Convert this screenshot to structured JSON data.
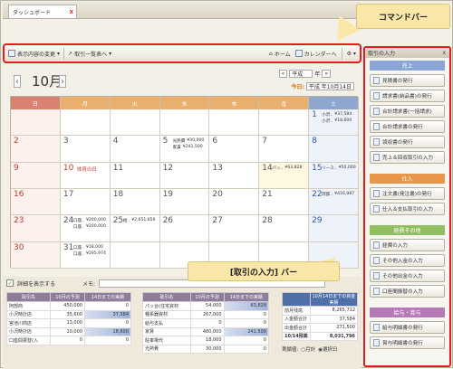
{
  "tab": {
    "label": "ダッシュボード",
    "close": "x"
  },
  "callouts": {
    "command_bar": "コマンドバー",
    "entry_bar": "[取引の入力] バー"
  },
  "toolbar": {
    "display_change": "表示内容の変更",
    "list": "取引一覧表へ",
    "home": "ホーム",
    "calendar": "カレンダーへ"
  },
  "calendar": {
    "month": "10月",
    "era": "平成",
    "year": "年",
    "today_label": "今日:",
    "today_value": "平成  年10月14日",
    "days": [
      "日",
      "月",
      "火",
      "水",
      "木",
      "金",
      "土"
    ],
    "cells": [
      {
        "d": "",
        "evs": []
      },
      {
        "d": "",
        "evs": []
      },
      {
        "d": "",
        "evs": []
      },
      {
        "d": "",
        "evs": []
      },
      {
        "d": "",
        "evs": []
      },
      {
        "d": "",
        "evs": []
      },
      {
        "d": "1",
        "evs": [
          [
            "小沢..",
            "¥37,584"
          ],
          [
            "小沢..",
            "¥18,600"
          ]
        ]
      },
      {
        "d": "2",
        "evs": []
      },
      {
        "d": "3",
        "evs": []
      },
      {
        "d": "4",
        "evs": []
      },
      {
        "d": "5",
        "evs": [
          [
            "光熱費",
            "¥30,000"
          ],
          [
            "家賃",
            "¥241,500"
          ]
        ]
      },
      {
        "d": "6",
        "evs": []
      },
      {
        "d": "7",
        "evs": []
      },
      {
        "d": "8",
        "evs": []
      },
      {
        "d": "9",
        "evs": []
      },
      {
        "d": "10",
        "holiday": "体育の日",
        "evs": []
      },
      {
        "d": "11",
        "evs": []
      },
      {
        "d": "12",
        "evs": []
      },
      {
        "d": "13",
        "evs": []
      },
      {
        "d": "14",
        "evs": [
          [
            "パッ..",
            "¥63,828"
          ]
        ]
      },
      {
        "d": "15",
        "evs": [
          [
            "リース..",
            "¥50,000"
          ]
        ]
      },
      {
        "d": "16",
        "evs": []
      },
      {
        "d": "17",
        "evs": []
      },
      {
        "d": "18",
        "evs": []
      },
      {
        "d": "19",
        "evs": []
      },
      {
        "d": "20",
        "evs": []
      },
      {
        "d": "21",
        "evs": []
      },
      {
        "d": "22",
        "evs": [
          [
            "阿部..",
            "¥416,987"
          ]
        ]
      },
      {
        "d": "23",
        "evs": []
      },
      {
        "d": "24",
        "evs": [
          [
            "口座..",
            "¥200,000"
          ],
          [
            "口座..",
            "¥200,000"
          ]
        ]
      },
      {
        "d": "25",
        "evs": [
          [
            "給..",
            "¥2,651,656"
          ]
        ]
      },
      {
        "d": "26",
        "evs": []
      },
      {
        "d": "27",
        "evs": []
      },
      {
        "d": "28",
        "evs": []
      },
      {
        "d": "29",
        "evs": []
      },
      {
        "d": "30",
        "evs": []
      },
      {
        "d": "31",
        "evs": [
          [
            "口座..",
            "¥18,000"
          ],
          [
            "口座..",
            "¥295,974"
          ]
        ]
      },
      {
        "d": "",
        "evs": []
      },
      {
        "d": "",
        "evs": []
      },
      {
        "d": "",
        "evs": []
      },
      {
        "d": "",
        "evs": []
      },
      {
        "d": "",
        "evs": []
      }
    ]
  },
  "bottom": {
    "detail_toggle": "詳細を表示する",
    "memo_label": "メモ:",
    "table1": {
      "headers": [
        "取引先",
        "10月の予測",
        "14日までの実績"
      ],
      "rows": [
        [
          "阿部商",
          "450,000",
          "0"
        ],
        [
          "小沢時計店",
          "35,600",
          "37,584"
        ],
        [
          "宮池川商店",
          "13,000",
          "0"
        ],
        [
          "小沢時計店",
          "10,000",
          "18,600"
        ],
        [
          "口座間振替(入",
          "0",
          "0"
        ]
      ]
    },
    "table2": {
      "headers": [
        "取引名",
        "10月の予測",
        "14日までの実績"
      ],
      "rows": [
        [
          "パッ合(住宅資材",
          "54,000",
          "63,828"
        ],
        [
          "種系器資材",
          "267,000",
          "0"
        ],
        [
          "給与支払",
          "0",
          "0"
        ],
        [
          "家賃",
          "480,000",
          "241,500"
        ],
        [
          "駐車場代",
          "18,000",
          "0"
        ],
        [
          "光熱費",
          "30,000",
          "0"
        ]
      ]
    },
    "table3": {
      "headers": [
        "",
        "10月14日までの資金実績"
      ],
      "rows": [
        [
          "前月残高",
          "8,265,712"
        ],
        [
          "入金額合計",
          "37,584"
        ],
        [
          "出金額合計",
          "271,500"
        ],
        [
          "10/14残高",
          "8,031,796"
        ]
      ],
      "basis_label": "実績値:",
      "basis_opts": [
        "月計",
        "選択日"
      ]
    }
  },
  "panel": {
    "title": "取引の入力",
    "close": "x",
    "sections": [
      {
        "label": "売上",
        "color": "#8aa6d6",
        "items": [
          "見積書の発行",
          "請求書(納品書)の発行",
          "合計請求書(一括請求)",
          "合計請求書の発行",
          "領収書の発行",
          "売上＆回収取引の入力"
        ]
      },
      {
        "label": "仕入",
        "color": "#e8964a",
        "items": [
          "注文書(発注書)の発行",
          "仕入＆支払取引の入力"
        ]
      },
      {
        "label": "経費その他",
        "color": "#8fbf5e",
        "items": [
          "経費の入力",
          "その他入金の入力",
          "その他出金の入力",
          "口座間振替の入力"
        ]
      },
      {
        "label": "給与・賞与",
        "color": "#b57ab5",
        "items": [
          "給与明細書の発行",
          "賞与明細書の発行"
        ]
      }
    ]
  }
}
